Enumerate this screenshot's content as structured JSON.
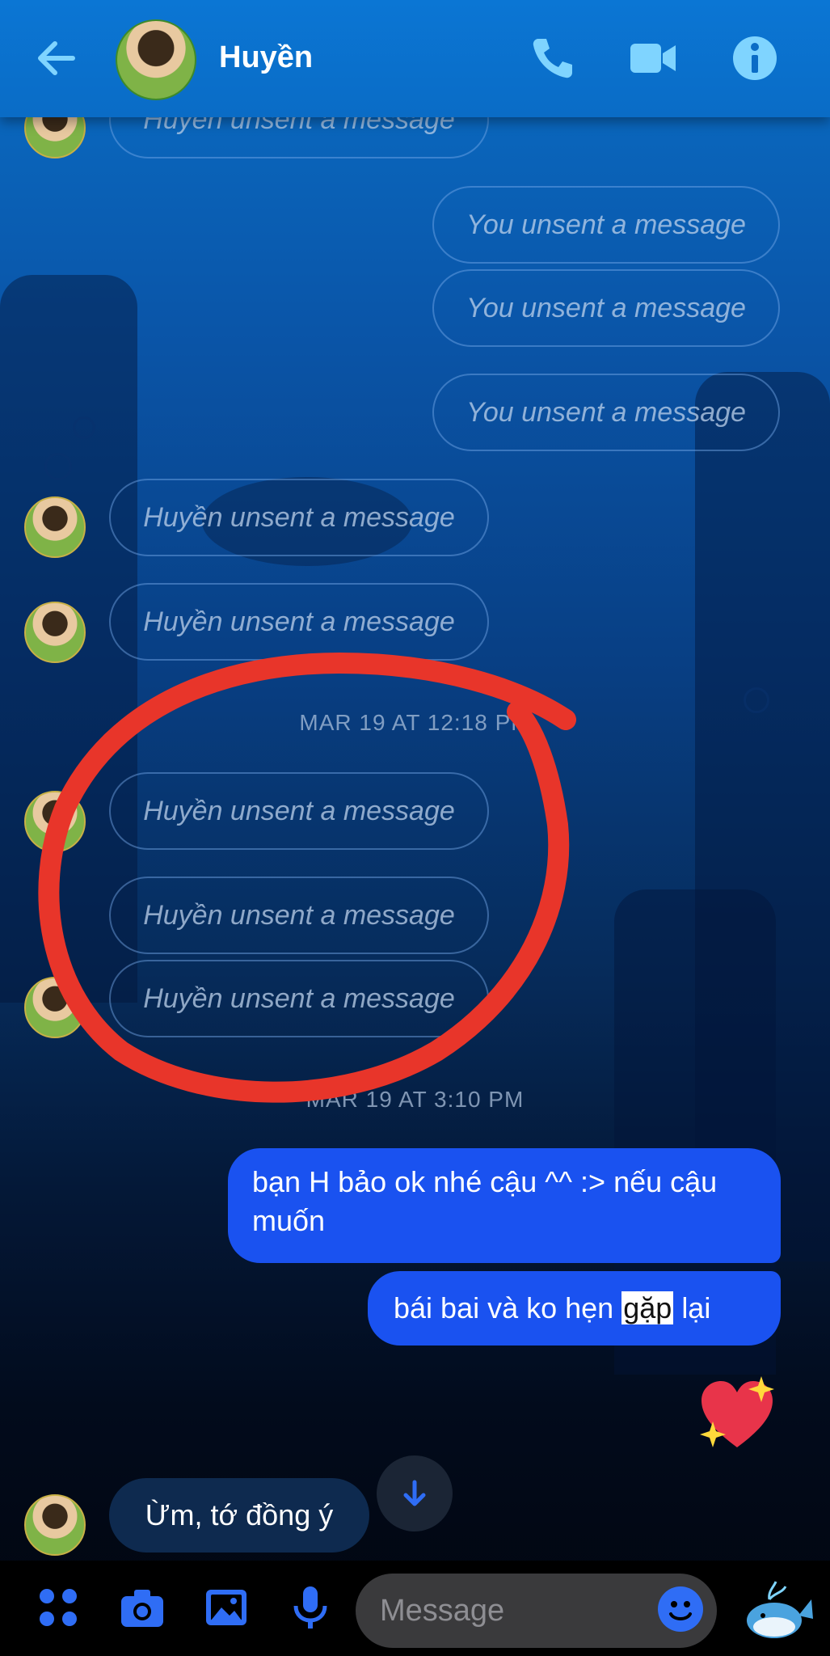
{
  "header": {
    "contact_name": "Huyền",
    "icons": [
      "back-arrow-icon",
      "phone-icon",
      "video-camera-icon",
      "info-icon"
    ]
  },
  "messages": {
    "huyen_unsent": "Huyền unsent a message",
    "you_unsent": "You unsent a message",
    "timestamps": [
      "MAR 19 AT 12:18 PM",
      "MAR 19 AT 3:10 PM"
    ],
    "sent": [
      "bạn H bảo ok nhé cậu ^^ :> nếu cậu muốn",
      "bái bai và ko hẹn",
      "gặp",
      "lại"
    ],
    "reply": "Ừm, tớ đồng ý"
  },
  "composer": {
    "placeholder": "Message",
    "icons": [
      "menu-grid-icon",
      "camera-icon",
      "gallery-icon",
      "microphone-icon",
      "emoji-icon",
      "whale-sticker-icon"
    ]
  },
  "colors": {
    "header": "#0a6cc6",
    "sent_bubble": "#1a52f0",
    "annotation_circle": "#e8352a"
  }
}
